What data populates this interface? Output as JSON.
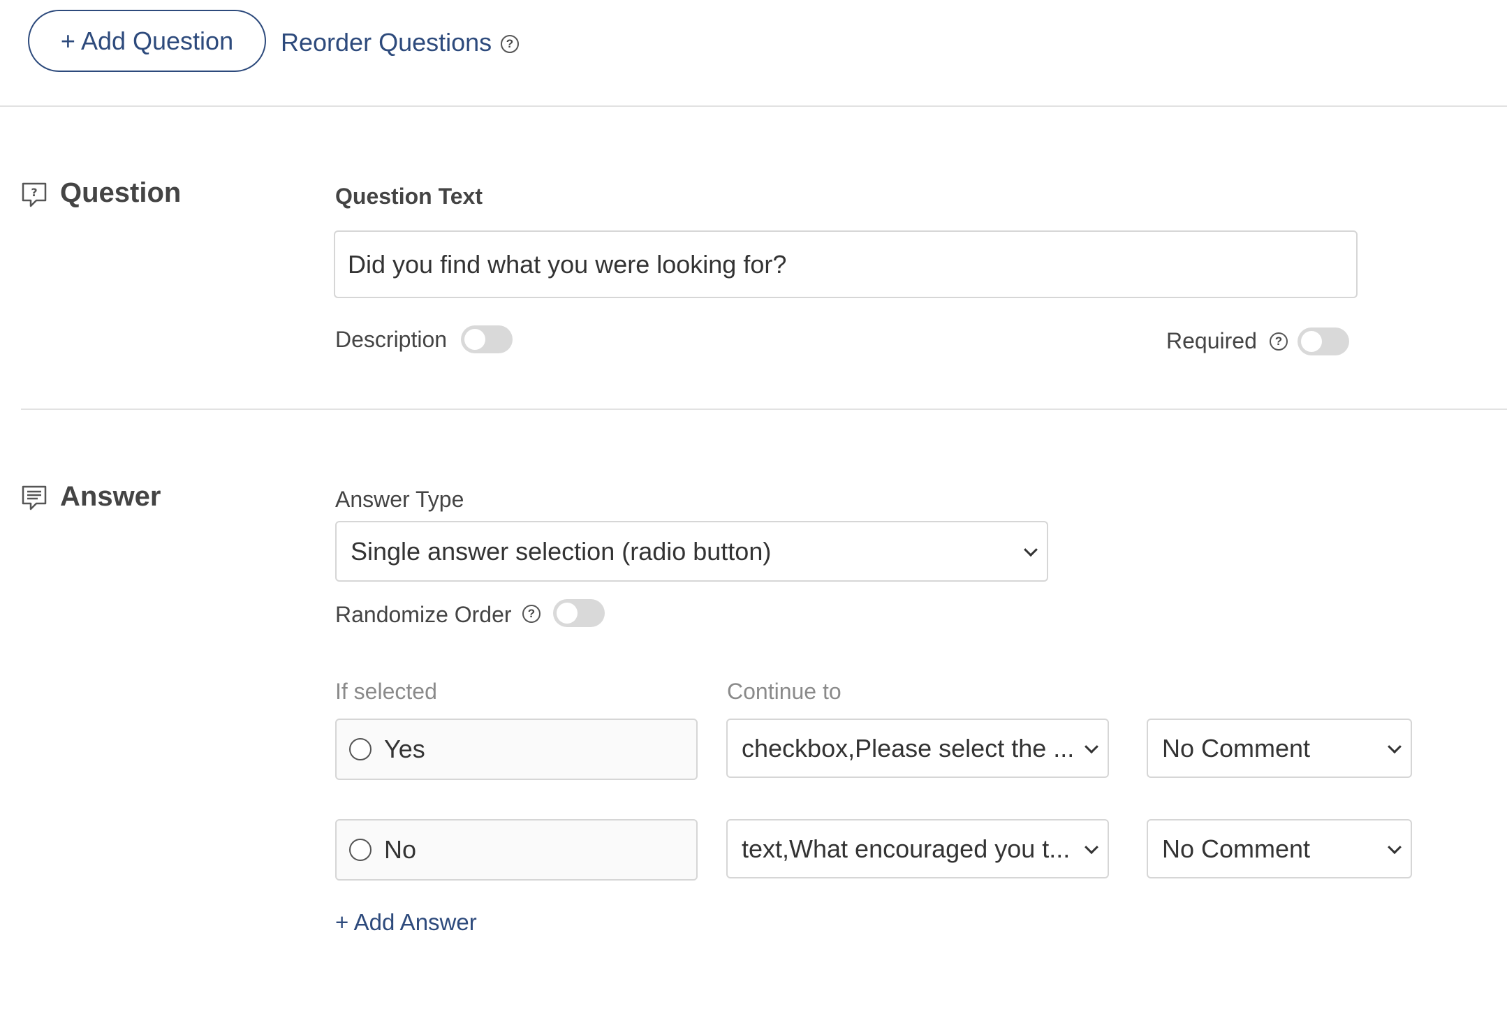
{
  "toolbar": {
    "add_question_label": "+ Add Question",
    "reorder_label": "Reorder Questions",
    "help_glyph": "?"
  },
  "question": {
    "section_title": "Question",
    "section_icon": "question-bubble-icon",
    "text_label": "Question Text",
    "text_value": "Did you find what you were looking for?",
    "description_label": "Description",
    "description_on": false,
    "required_label": "Required",
    "required_on": false
  },
  "answer": {
    "section_title": "Answer",
    "section_icon": "comment-lines-icon",
    "type_label": "Answer Type",
    "type_value": "Single answer selection (radio button)",
    "randomize_label": "Randomize Order",
    "randomize_on": false,
    "col_if_selected": "If selected",
    "col_continue_to": "Continue to",
    "rows": [
      {
        "answer": "Yes",
        "continue_to": "checkbox,Please select the ...",
        "comment": "No Comment"
      },
      {
        "answer": "No",
        "continue_to": "text,What encouraged you t...",
        "comment": "No Comment"
      }
    ],
    "add_answer_label": "+ Add Answer"
  }
}
